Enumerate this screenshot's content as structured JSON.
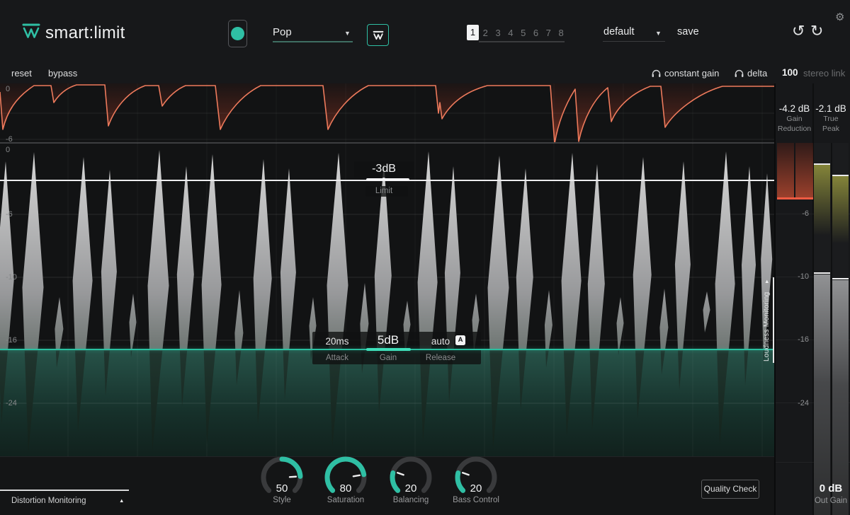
{
  "header": {
    "app_name": "smart:limit",
    "genre_profile": "Pop",
    "slots": [
      "1",
      "2",
      "3",
      "4",
      "5",
      "6",
      "7",
      "8"
    ],
    "active_slot": "1",
    "preset_name": "default",
    "save_label": "save"
  },
  "toolbar": {
    "reset": "reset",
    "bypass": "bypass",
    "constant_gain": "constant gain",
    "delta": "delta",
    "stereo_link_value": "100",
    "stereo_link_label": "stereo link"
  },
  "display": {
    "top_axis": [
      "0",
      "-6"
    ],
    "main_axis": [
      "0",
      "-6",
      "-10",
      "-16",
      "-24"
    ],
    "limit": {
      "value": "-3dB",
      "label": "Limit"
    },
    "attack": {
      "value": "20ms",
      "label": "Attack"
    },
    "gain": {
      "value": "5dB",
      "label": "Gain"
    },
    "release": {
      "value": "auto",
      "badge": "A",
      "label": "Release"
    },
    "loudness_monitoring": "Loudness Monitoring"
  },
  "meters": {
    "gain_reduction": {
      "value": "-4.2 dB",
      "line1": "Gain",
      "line2": "Reduction"
    },
    "true_peak": {
      "value": "-2.1 dB",
      "line1": "True",
      "line2": "Peak"
    },
    "axis": [
      "-6",
      "-10",
      "-16",
      "-24"
    ],
    "out_gain": {
      "value": "0 dB",
      "label": "Out Gain"
    }
  },
  "footer": {
    "knobs": [
      {
        "value": "50",
        "label": "Style",
        "fill_from": 0.5,
        "fill_to": 0.82,
        "pointer": 0.82
      },
      {
        "value": "80",
        "label": "Saturation",
        "fill_from": 0,
        "fill_to": 0.8,
        "pointer": 0.8
      },
      {
        "value": "20",
        "label": "Balancing",
        "fill_from": 0,
        "fill_to": 0.22,
        "pointer": 0.24
      },
      {
        "value": "20",
        "label": "Bass Control",
        "fill_from": 0,
        "fill_to": 0.22,
        "pointer": 0.24
      }
    ],
    "quality_check": "Quality Check",
    "distortion_monitoring": "Distortion Monitoring"
  },
  "colors": {
    "accent": "#2fbfa4",
    "accent_bright": "#3fe0ba",
    "warning": "#ed7a5c"
  }
}
